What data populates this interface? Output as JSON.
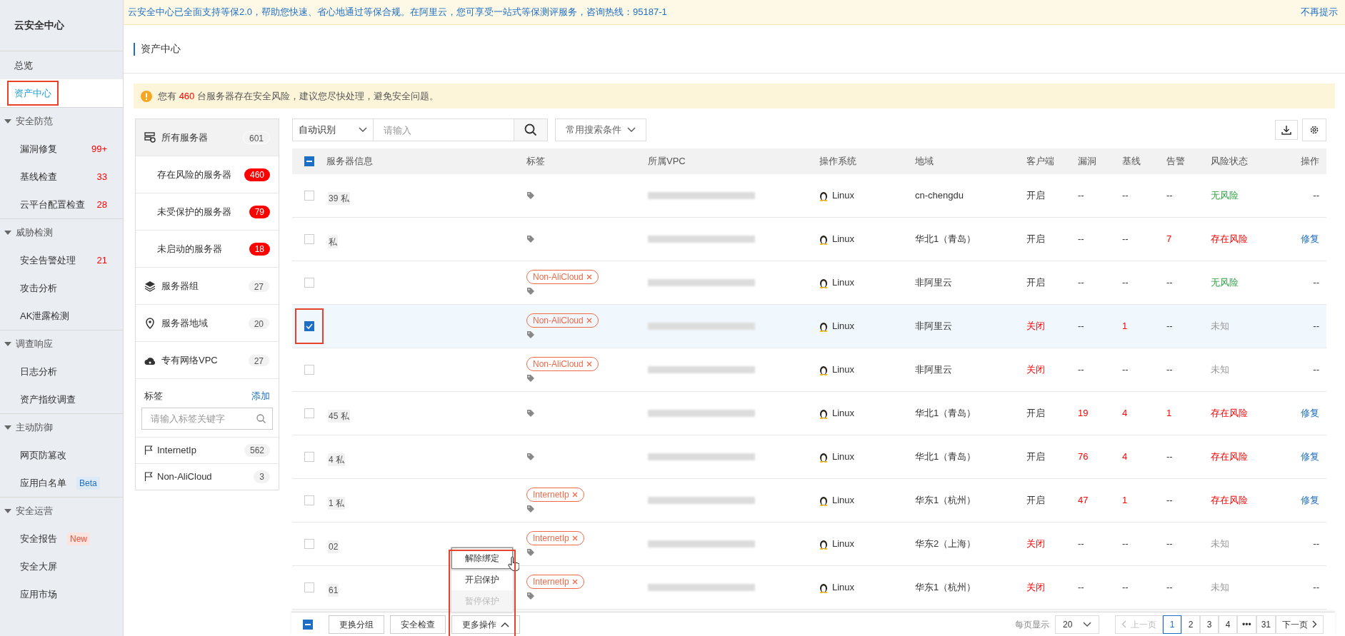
{
  "sidebar": {
    "title": "云安全中心",
    "items": [
      {
        "label": "总览",
        "selected": false
      },
      {
        "label": "资产中心",
        "selected": true
      }
    ],
    "sections": [
      {
        "label": "安全防范",
        "expanded": true,
        "children": [
          {
            "label": "漏洞修复",
            "badge": {
              "text": "99+",
              "kind": "count"
            }
          },
          {
            "label": "基线检查",
            "badge": {
              "text": "33",
              "kind": "count"
            }
          },
          {
            "label": "云平台配置检查",
            "badge": {
              "text": "28",
              "kind": "count"
            }
          }
        ]
      },
      {
        "label": "威胁检测",
        "expanded": true,
        "children": [
          {
            "label": "安全告警处理",
            "badge": {
              "text": "21",
              "kind": "count"
            }
          },
          {
            "label": "攻击分析"
          },
          {
            "label": "AK泄露检测"
          }
        ]
      },
      {
        "label": "调查响应",
        "expanded": true,
        "children": [
          {
            "label": "日志分析"
          },
          {
            "label": "资产指纹调查"
          }
        ]
      },
      {
        "label": "主动防御",
        "expanded": true,
        "children": [
          {
            "label": "网页防篡改"
          },
          {
            "label": "应用白名单",
            "badge": {
              "text": "Beta",
              "kind": "beta"
            }
          }
        ]
      },
      {
        "label": "安全运营",
        "expanded": true,
        "children": [
          {
            "label": "安全报告",
            "badge": {
              "text": "New",
              "kind": "new"
            }
          },
          {
            "label": "安全大屏"
          },
          {
            "label": "应用市场"
          }
        ]
      }
    ]
  },
  "banner": {
    "text": "云安全中心已全面支持等保2.0，帮助您快速、省心地通过等保合规。在阿里云，您可享受一站式等保测评服务，咨询热线：95187-1",
    "dismiss": "不再提示"
  },
  "page_title": "资产中心",
  "warning": {
    "before": "您有",
    "count": "460",
    "after": "台服务器存在安全风险，建议您尽快处理，避免安全问题。"
  },
  "filters": {
    "groups": [
      {
        "label": "所有服务器",
        "count": "601",
        "kind": "main",
        "selected": true
      },
      {
        "label": "存在风险的服务器",
        "count": "460",
        "kind": "sub",
        "selected": false
      },
      {
        "label": "未受保护的服务器",
        "count": "79",
        "kind": "sub",
        "selected": false
      },
      {
        "label": "未启动的服务器",
        "count": "18",
        "kind": "sub",
        "selected": false
      },
      {
        "label": "服务器组",
        "count": "27",
        "kind": "main",
        "selected": false
      },
      {
        "label": "服务器地域",
        "count": "20",
        "kind": "main",
        "selected": false
      },
      {
        "label": "专有网络VPC",
        "count": "27",
        "kind": "main",
        "selected": false
      }
    ],
    "tags_heading": "标签",
    "tags_add": "添加",
    "tag_search": {
      "placeholder": "请输入标签关键字"
    },
    "tags": [
      {
        "label": "InternetIp",
        "count": "562"
      },
      {
        "label": "Non-AliCloud",
        "count": "3"
      }
    ]
  },
  "toolbar": {
    "search_type": "自动识别",
    "search": {
      "placeholder": "请输入"
    },
    "saved_conditions": "常用搜索条件"
  },
  "table": {
    "header_checkbox_partial": true,
    "columns": [
      "服务器信息",
      "标签",
      "所属VPC",
      "操作系统",
      "地域",
      "客户端",
      "漏洞",
      "基线",
      "告警",
      "风险状态",
      "操作"
    ],
    "rows": [
      {
        "selected": false,
        "server_suffix": "39 私",
        "tags": [],
        "os": "Linux",
        "region": "cn-chengdu",
        "client": "开启",
        "client_on": true,
        "vuln": "--",
        "baseline": "--",
        "alert": "--",
        "risk": {
          "text": "无风险",
          "kind": "safe"
        },
        "action": "--"
      },
      {
        "selected": false,
        "server_suffix": "私",
        "tags": [],
        "os": "Linux",
        "region": "华北1（青岛）",
        "client": "开启",
        "client_on": true,
        "vuln": "--",
        "baseline": "--",
        "alert": "7",
        "risk": {
          "text": "存在风险",
          "kind": "risk"
        },
        "action": "修复"
      },
      {
        "selected": false,
        "tags": [
          "Non-AliCloud"
        ],
        "os": "Linux",
        "region": "非阿里云",
        "client": "开启",
        "client_on": true,
        "vuln": "--",
        "baseline": "--",
        "alert": "--",
        "risk": {
          "text": "无风险",
          "kind": "safe"
        },
        "action": "--"
      },
      {
        "selected": true,
        "tags": [
          "Non-AliCloud"
        ],
        "os": "Linux",
        "region": "非阿里云",
        "client": "关闭",
        "client_on": false,
        "vuln": "--",
        "baseline": "1",
        "alert": "--",
        "risk": {
          "text": "未知",
          "kind": "unknown"
        },
        "action": "--"
      },
      {
        "selected": false,
        "tags": [
          "Non-AliCloud"
        ],
        "os": "Linux",
        "region": "非阿里云",
        "client": "关闭",
        "client_on": false,
        "vuln": "--",
        "baseline": "--",
        "alert": "--",
        "risk": {
          "text": "未知",
          "kind": "unknown"
        },
        "action": "--"
      },
      {
        "selected": false,
        "server_suffix": "45 私",
        "tags": [],
        "os": "Linux",
        "region": "华北1（青岛）",
        "client": "开启",
        "client_on": true,
        "vuln": "19",
        "baseline": "4",
        "alert": "1",
        "risk": {
          "text": "存在风险",
          "kind": "risk"
        },
        "action": "修复"
      },
      {
        "selected": false,
        "server_suffix": "4 私",
        "tags": [],
        "os": "Linux",
        "region": "华北1（青岛）",
        "client": "开启",
        "client_on": true,
        "vuln": "76",
        "baseline": "4",
        "alert": "--",
        "risk": {
          "text": "存在风险",
          "kind": "risk"
        },
        "action": "修复"
      },
      {
        "selected": false,
        "server_suffix": "1 私",
        "tags": [
          "InternetIp"
        ],
        "os": "Linux",
        "region": "华东1（杭州）",
        "client": "开启",
        "client_on": true,
        "vuln": "47",
        "baseline": "1",
        "alert": "--",
        "risk": {
          "text": "存在风险",
          "kind": "risk"
        },
        "action": "修复"
      },
      {
        "selected": false,
        "server_suffix": "02",
        "tags": [
          "InternetIp"
        ],
        "os": "Linux",
        "region": "华东2（上海）",
        "client": "关闭",
        "client_on": false,
        "vuln": "--",
        "baseline": "--",
        "alert": "--",
        "risk": {
          "text": "未知",
          "kind": "unknown"
        },
        "action": "--"
      },
      {
        "selected": false,
        "server_suffix": "61",
        "tags": [
          "InternetIp"
        ],
        "os": "Linux",
        "region": "华东1（杭州）",
        "client": "关闭",
        "client_on": false,
        "vuln": "--",
        "baseline": "--",
        "alert": "--",
        "risk": {
          "text": "未知",
          "kind": "unknown"
        },
        "action": "--"
      }
    ]
  },
  "bottom_bar": {
    "checkbox_partial": true,
    "buttons": [
      "更换分组",
      "安全检查"
    ],
    "more": "更多操作",
    "more_expanded": true,
    "menu": [
      {
        "label": "解除绑定",
        "hovered": true,
        "disabled": false
      },
      {
        "label": "开启保护",
        "hovered": false,
        "disabled": false
      },
      {
        "label": "暂停保护",
        "hovered": false,
        "disabled": true
      }
    ],
    "page_size_label": "每页显示",
    "page_size": "20",
    "prev": "上一页",
    "next": "下一页",
    "pages": [
      {
        "label": "1",
        "selected": true
      },
      {
        "label": "2",
        "selected": false
      },
      {
        "label": "3",
        "selected": false
      },
      {
        "label": "4",
        "selected": false
      },
      {
        "label": "•••",
        "selected": false
      },
      {
        "label": "31",
        "selected": false
      }
    ]
  }
}
